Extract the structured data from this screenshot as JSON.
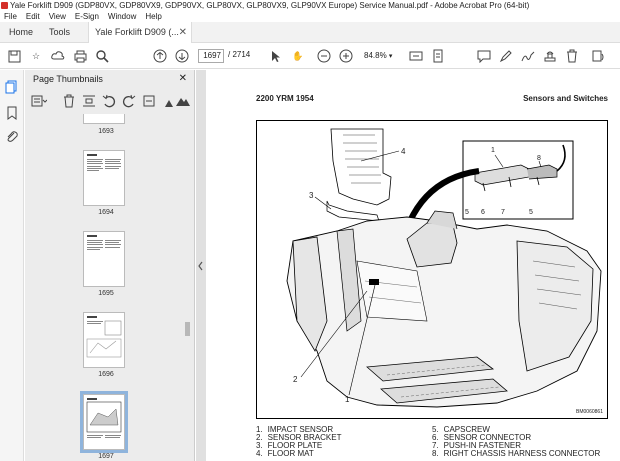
{
  "window": {
    "title": "Yale Forklift D909 (GDP80VX, GDP80VX9, GDP90VX, GLP80VX, GLP80VX9, GLP90VX Europe) Service Manual.pdf - Adobe Acrobat Pro (64-bit)"
  },
  "menu": [
    "File",
    "Edit",
    "View",
    "E-Sign",
    "Window",
    "Help"
  ],
  "tabs": {
    "home": "Home",
    "tools": "Tools",
    "document": "Yale Forklift D909 (..."
  },
  "toolbar": {
    "current_page": "1697",
    "total_pages": "/ 2714",
    "zoom": "84.8%"
  },
  "thumbnails_panel": {
    "title": "Page Thumbnails",
    "pages": [
      "1693",
      "1694",
      "1695",
      "1696",
      "1697"
    ],
    "selected": "1697"
  },
  "document": {
    "header_left": "2200 YRM 1954",
    "header_right": "Sensors and Switches",
    "figure_code": "BM0060861",
    "callouts": [
      "1",
      "2",
      "3",
      "4",
      "5",
      "6",
      "7",
      "8"
    ],
    "legend": [
      {
        "num": "1.",
        "text": "IMPACT SENSOR"
      },
      {
        "num": "2.",
        "text": "SENSOR BRACKET"
      },
      {
        "num": "3.",
        "text": "FLOOR PLATE"
      },
      {
        "num": "4.",
        "text": "FLOOR MAT"
      },
      {
        "num": "5.",
        "text": "CAPSCREW"
      },
      {
        "num": "6.",
        "text": "SENSOR CONNECTOR"
      },
      {
        "num": "7.",
        "text": "PUSH-IN FASTENER"
      },
      {
        "num": "8.",
        "text": "RIGHT CHASSIS HARNESS CONNECTOR"
      }
    ]
  }
}
